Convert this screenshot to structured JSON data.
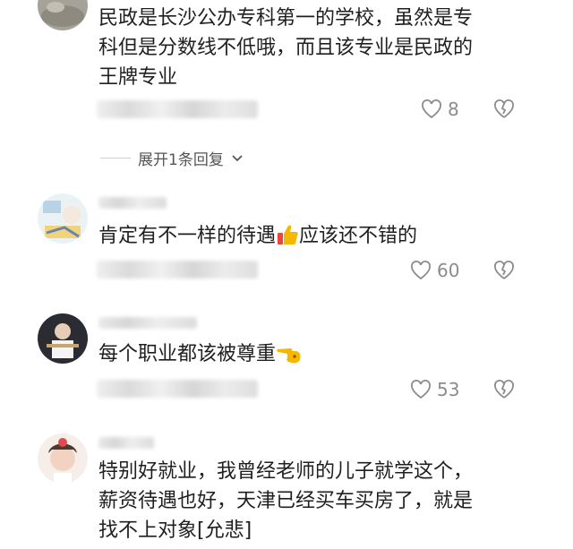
{
  "comments": [
    {
      "lines": [
        "民政是长沙公办专科第一的学校，虽然是专",
        "科但是分数线不低哦，而且该专业是民政的",
        "王牌专业"
      ],
      "likes": "8"
    },
    {
      "text_before_emoji": "肯定有不一样的待遇",
      "emoji": "thumbs-up-icon",
      "text_after_emoji": "应该还不错的",
      "likes": "60"
    },
    {
      "text": "每个职业都该被尊重",
      "emoji": "pointing-hand-icon",
      "likes": "53"
    },
    {
      "lines": [
        "特别好就业，我曾经老师的儿子就学这个，",
        "薪资待遇也好，天津已经买车买房了，就是",
        "找不上对象[允悲]"
      ]
    }
  ],
  "expand_replies_label": "展开1条回复",
  "colors": {
    "text": "#1f1f1f",
    "meta": "#8c8c8c",
    "emoji_yellow": "#f5b700",
    "emoji_red": "#e8453c"
  }
}
